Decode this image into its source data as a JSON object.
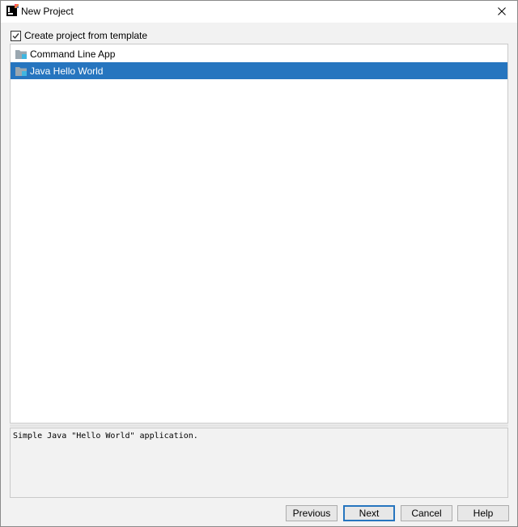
{
  "window": {
    "title": "New Project",
    "icon": "intellij-idea-icon",
    "close_icon": "close-icon"
  },
  "template_option": {
    "label": "Create project from template",
    "checked": true
  },
  "templates": [
    {
      "label": "Command Line App",
      "icon": "folder-icon",
      "selected": false
    },
    {
      "label": "Java Hello World",
      "icon": "folder-icon",
      "selected": true
    }
  ],
  "description": "Simple Java \"Hello World\" application.",
  "buttons": {
    "previous": "Previous",
    "next": "Next",
    "cancel": "Cancel",
    "help": "Help"
  },
  "colors": {
    "selection": "#2675bf",
    "default_button_border": "#2675bf"
  }
}
